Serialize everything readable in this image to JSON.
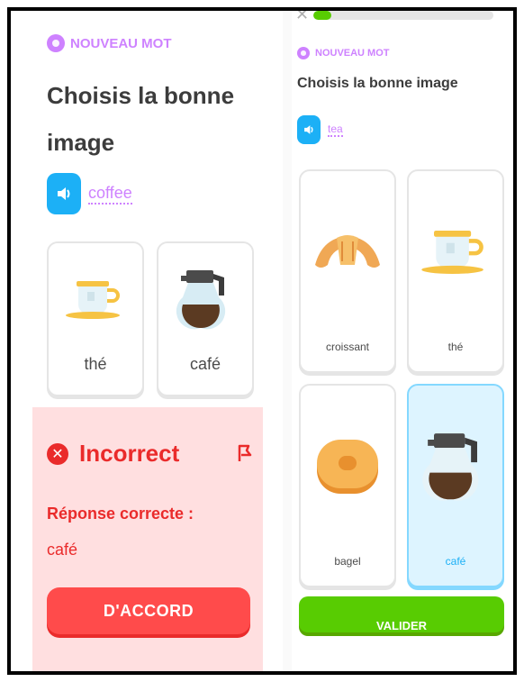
{
  "left": {
    "new_word": "NOUVEAU MOT",
    "title_line1": "Choisis la bonne",
    "title_line2": "image",
    "audio_word": "coffee",
    "options": [
      {
        "label": "thé",
        "icon": "tea-cup-icon"
      },
      {
        "label": "café",
        "icon": "coffee-pot-icon"
      }
    ],
    "feedback": {
      "status": "Incorrect",
      "correct_label": "Réponse correcte :",
      "correct_answer": "café",
      "button": "D'ACCORD"
    }
  },
  "right": {
    "progress": 0.1,
    "new_word": "NOUVEAU MOT",
    "title": "Choisis la bonne image",
    "audio_word": "tea",
    "options": [
      {
        "label": "croissant",
        "icon": "croissant-icon",
        "selected": false
      },
      {
        "label": "thé",
        "icon": "tea-cup-icon",
        "selected": false
      },
      {
        "label": "bagel",
        "icon": "bagel-icon",
        "selected": false
      },
      {
        "label": "café",
        "icon": "coffee-pot-icon",
        "selected": true
      }
    ],
    "button": "VALIDER"
  },
  "colors": {
    "accent_purple": "#ce82ff",
    "blue": "#1cb0f6",
    "red": "#ff4b4b",
    "green": "#58cc02",
    "error_bg": "#ffdfe0"
  }
}
